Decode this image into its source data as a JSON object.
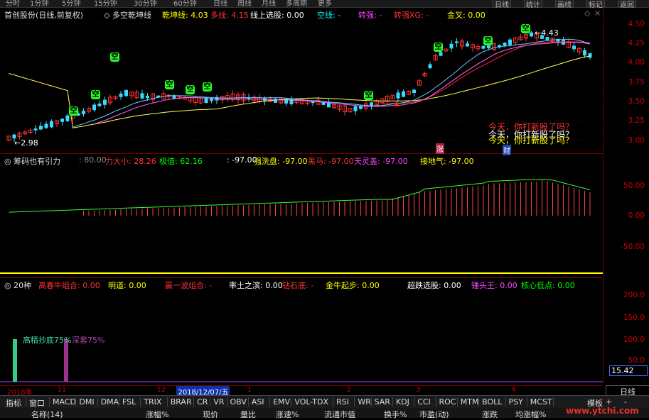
{
  "top_tabs": [
    "分时",
    "1分钟",
    "5分钟",
    "15分钟",
    "30分钟",
    "60分钟",
    "日线",
    "周线",
    "月线",
    "多周期",
    "更多"
  ],
  "top_right": [
    "日线",
    "统计",
    "画线",
    "标记",
    "返回"
  ],
  "main_header": [
    {
      "text": "首创股份(日线,前复权)",
      "color": "#dddddd"
    },
    {
      "text": "◇ 多空乾坤线",
      "color": "#dddddd"
    },
    {
      "text": "乾坤线: 4.03",
      "color": "#ffff00"
    },
    {
      "text": "多线: 4.15",
      "color": "#ff3333"
    },
    {
      "text": "线上选股: 0.00",
      "color": "#ffffff"
    },
    {
      "text": "空线: -",
      "color": "#00ffff"
    },
    {
      "text": "转强: -",
      "color": "#ff44ff"
    },
    {
      "text": "转强XG: -",
      "color": "#ff3333"
    },
    {
      "text": "金叉: 0.00",
      "color": "#ffff00"
    }
  ],
  "main_yaxis": [
    "4.50",
    "4.25",
    "4.00",
    "3.75",
    "3.50",
    "3.25",
    "3.00"
  ],
  "price_annotations": {
    "low": "2.98",
    "high": "4.43"
  },
  "flag_label": "空",
  "zhang_label": "涨",
  "cai_label": "财",
  "notes": [
    {
      "text": "今天，你打新股了吗？",
      "color": "#ff3333"
    },
    {
      "text": "今天，你打新股了吗？",
      "color": "#ffffff"
    },
    {
      "text": "今天，你打新股了吗？",
      "color": "#ffff00"
    }
  ],
  "pane2_header": [
    {
      "text": "◎ 筹码也有引力",
      "color": "#dddddd"
    },
    {
      "text": ": 80.00",
      "color": "#888888"
    },
    {
      "text": "力大小: 28.26",
      "color": "#ff3333"
    },
    {
      "text": "极值: 62.16",
      "color": "#00ff00"
    },
    {
      "text": ": -97.00",
      "color": "#ffffff"
    },
    {
      "text": "强洗盘: -97.00",
      "color": "#ffff00"
    },
    {
      "text": "黑马: -97.00",
      "color": "#ff3333"
    },
    {
      "text": "天灵盖: -97.00",
      "color": "#ff44ff"
    },
    {
      "text": "接地气: -97.00",
      "color": "#ffff00"
    }
  ],
  "pane2_yaxis": [
    "50.00",
    "0.00",
    "-50.00"
  ],
  "pane3_header": [
    {
      "text": "◎ 20种",
      "color": "#dddddd"
    },
    {
      "text": "高春牛组合: 0.00",
      "color": "#ff3333"
    },
    {
      "text": "明道: 0.00",
      "color": "#ffff00"
    },
    {
      "text": "赢一波组合: -",
      "color": "#ff3333"
    },
    {
      "text": "率土之滨: 0.00",
      "color": "#ffffff"
    },
    {
      "text": "钻石底: -",
      "color": "#ff3333"
    },
    {
      "text": "金牛起步: 0.00",
      "color": "#ffff00"
    },
    {
      "text": "超跌选股: 0.00",
      "color": "#ffffff"
    },
    {
      "text": "锤头王: 0.00",
      "color": "#ff44ff"
    },
    {
      "text": "核心低点: 0.00",
      "color": "#00ff00"
    }
  ],
  "pane3_yaxis": [
    "200.0",
    "150.0",
    "100.0",
    "50.0"
  ],
  "pane3_labels": [
    {
      "text": "高精抄底75%",
      "color": "#44ddaa"
    },
    {
      "text": "深套75%",
      "color": "#aa44aa"
    }
  ],
  "right_value": "15.42",
  "dates": [
    {
      "text": "2018年",
      "pos": 0.012
    },
    {
      "text": "11",
      "pos": 0.095
    },
    {
      "text": "12",
      "pos": 0.26
    },
    {
      "text": "2018/12/07/五",
      "pos": 0.293
    },
    {
      "text": "1",
      "pos": 0.41
    },
    {
      "text": "2",
      "pos": 0.575
    },
    {
      "text": "3",
      "pos": 0.69
    },
    {
      "text": "4",
      "pos": 0.848
    }
  ],
  "period_label": "日线",
  "bottom_tabs": [
    "指标",
    "窗口",
    "MACD",
    "DMI",
    "DMA",
    "FSL",
    "TRIX",
    "BRAR",
    "CR",
    "VR",
    "OBV",
    "ASI",
    "EMV",
    "VOL-TDX",
    "RSI",
    "WR",
    "SAR",
    "KDJ",
    "CCI",
    "ROC",
    "MTM",
    "BOLL",
    "PSY",
    "MCST"
  ],
  "bottom_right": [
    "模板",
    "+",
    "-"
  ],
  "columns": [
    "名称(14)",
    "涨幅%",
    "现价",
    "量比",
    "涨速%",
    "流通市值",
    "换手%",
    "市盈(动)",
    "涨跌",
    "均涨幅%"
  ],
  "watermark": "www.ytchi.com"
}
